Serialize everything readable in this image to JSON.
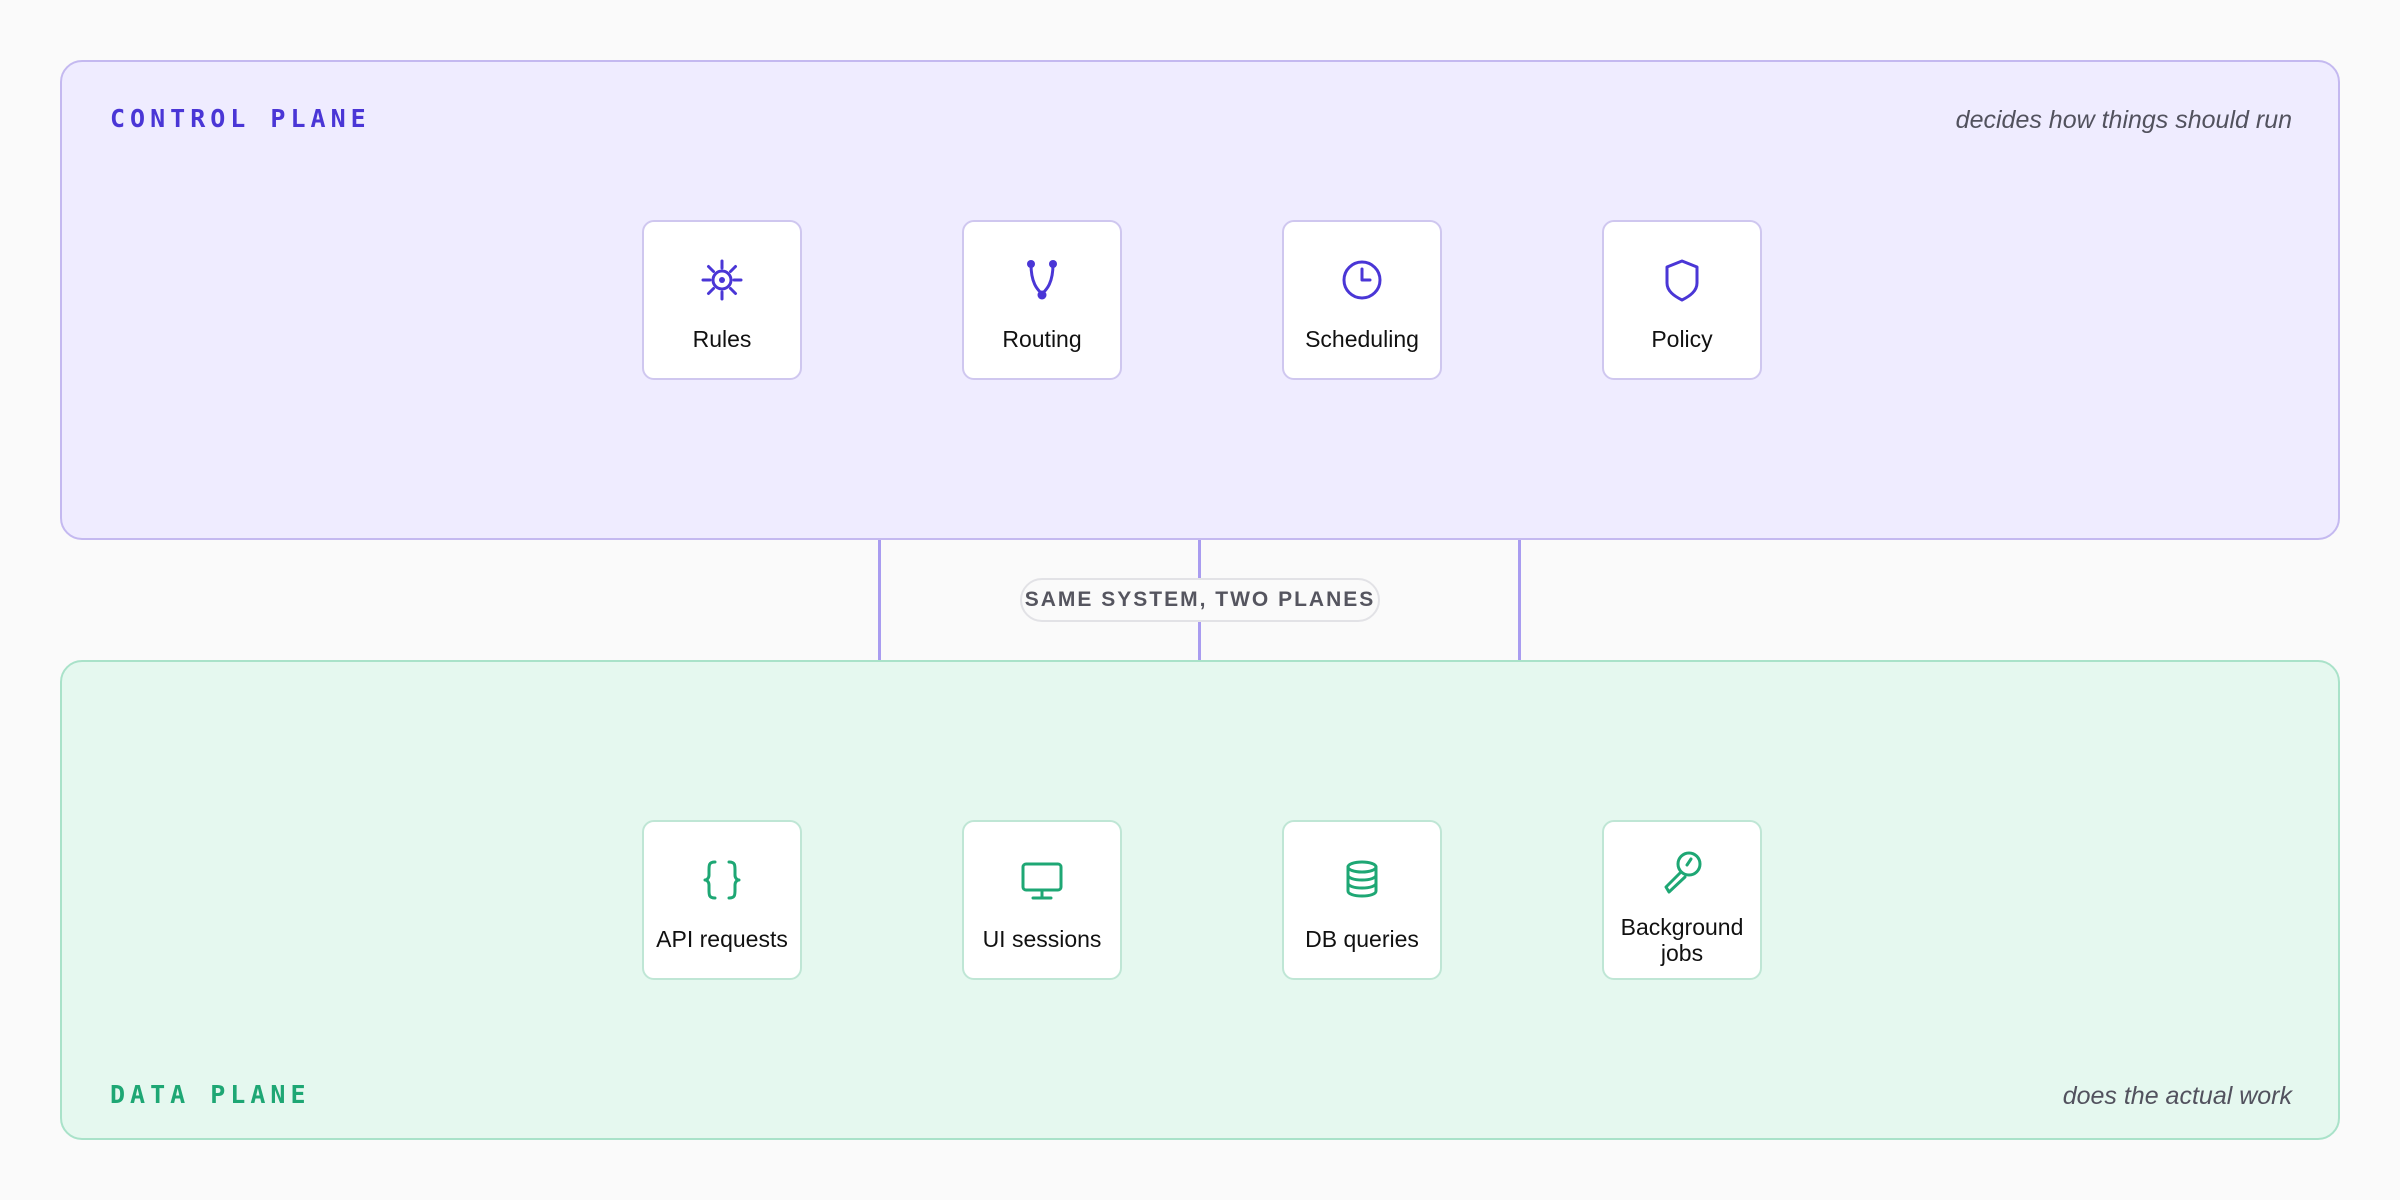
{
  "control_plane": {
    "title": "CONTROL PLANE",
    "caption": "decides how things should run",
    "accent": "#4a36d6",
    "cards": [
      {
        "label": "Rules",
        "icon": "gear-icon"
      },
      {
        "label": "Routing",
        "icon": "branch-icon"
      },
      {
        "label": "Scheduling",
        "icon": "clock-icon"
      },
      {
        "label": "Policy",
        "icon": "shield-icon"
      }
    ]
  },
  "data_plane": {
    "title": "DATA PLANE",
    "caption": "does the actual work",
    "accent": "#1ea774",
    "cards": [
      {
        "label": "API requests",
        "icon": "braces-icon"
      },
      {
        "label": "UI sessions",
        "icon": "monitor-icon"
      },
      {
        "label": "DB queries",
        "icon": "database-icon"
      },
      {
        "label": "Background jobs",
        "icon": "wrench-icon"
      }
    ]
  },
  "connector_label": "SAME SYSTEM, TWO PLANES"
}
